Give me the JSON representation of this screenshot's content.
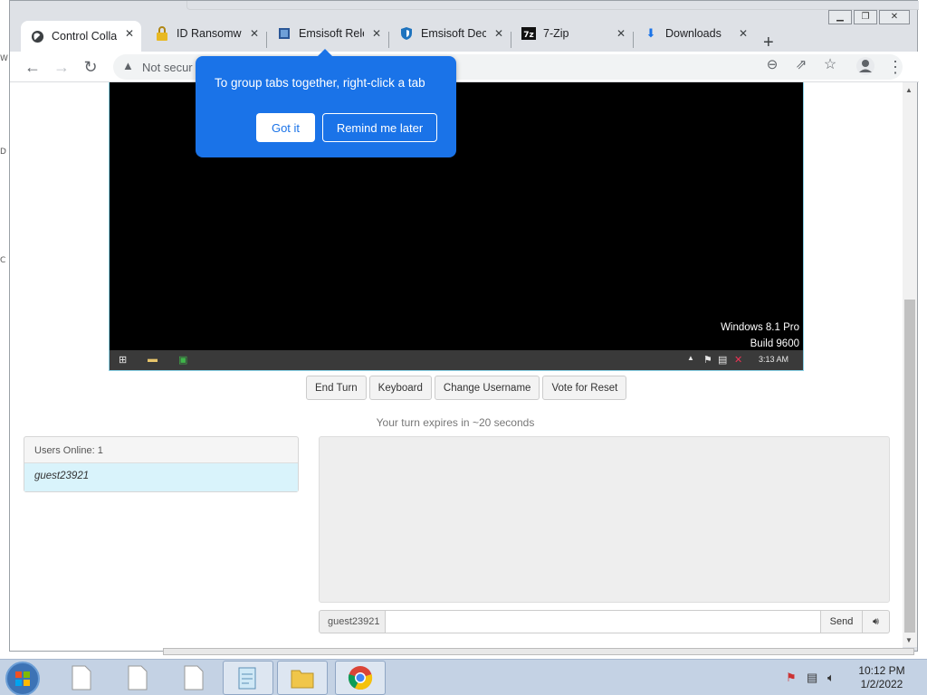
{
  "browser": {
    "tabs": [
      {
        "title": "Control Colla",
        "favicon": "globe-icon"
      },
      {
        "title": "ID Ransomwa",
        "favicon": "lock-icon"
      },
      {
        "title": "Emsisoft Rele",
        "favicon": "emsisoft-icon"
      },
      {
        "title": "Emsisoft Dec",
        "favicon": "shield-icon"
      },
      {
        "title": "7-Zip",
        "favicon": "7zip-icon"
      },
      {
        "title": "Downloads",
        "favicon": "download-icon"
      }
    ],
    "address": "Not secur",
    "accent_color": "#1a73e8"
  },
  "popup": {
    "message": "To group tabs together, right-click a tab",
    "got_it": "Got it",
    "remind_later": "Remind me later"
  },
  "vm": {
    "watermark_line1": "Windows 8.1 Pro",
    "watermark_line2": "Build 9600",
    "clock": "3:13 AM"
  },
  "controls": {
    "end_turn": "End Turn",
    "keyboard": "Keyboard",
    "change_username": "Change Username",
    "vote_reset": "Vote for Reset"
  },
  "turn_note": "Your turn expires in ~20 seconds",
  "users": {
    "header": "Users Online: 1",
    "list": [
      "guest23921"
    ]
  },
  "chat": {
    "username": "guest23921",
    "send": "Send"
  },
  "taskbar": {
    "time": "10:12 PM",
    "date": "1/2/2022"
  }
}
